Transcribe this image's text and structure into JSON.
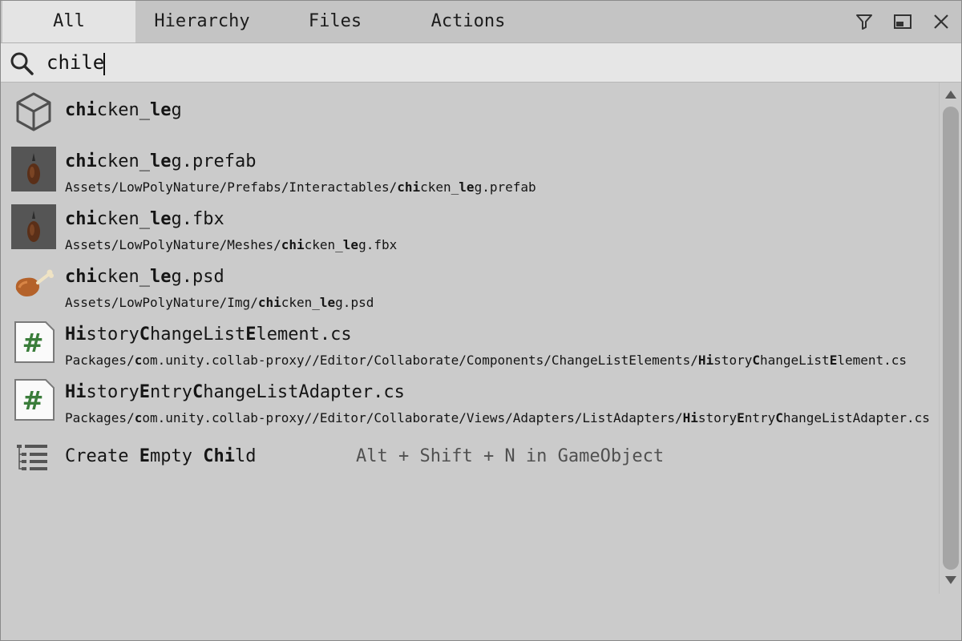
{
  "tabs": [
    {
      "label": "All",
      "active": true
    },
    {
      "label": "Hierarchy",
      "active": false
    },
    {
      "label": "Files",
      "active": false
    },
    {
      "label": "Actions",
      "active": false
    }
  ],
  "toolbar": {
    "icons": [
      "filter-icon",
      "dock-icon",
      "close-icon"
    ]
  },
  "search": {
    "value": "chile",
    "icon": "search-icon"
  },
  "results": [
    {
      "icon": "cube-icon",
      "title_parts": [
        {
          "t": "chi",
          "b": true
        },
        {
          "t": "cken_",
          "b": false
        },
        {
          "t": "le",
          "b": true
        },
        {
          "t": "g",
          "b": false
        }
      ]
    },
    {
      "icon": "prefab-thumbnail-icon",
      "title_parts": [
        {
          "t": "chi",
          "b": true
        },
        {
          "t": "cken_",
          "b": false
        },
        {
          "t": "le",
          "b": true
        },
        {
          "t": "g.prefab",
          "b": false
        }
      ],
      "path_parts": [
        {
          "t": "Assets/LowPolyNature/Prefabs/Interactables/",
          "b": false
        },
        {
          "t": "chi",
          "b": true
        },
        {
          "t": "cken_",
          "b": false
        },
        {
          "t": "le",
          "b": true
        },
        {
          "t": "g.prefab",
          "b": false
        }
      ]
    },
    {
      "icon": "mesh-thumbnail-icon",
      "title_parts": [
        {
          "t": "chi",
          "b": true
        },
        {
          "t": "cken_",
          "b": false
        },
        {
          "t": "le",
          "b": true
        },
        {
          "t": "g.fbx",
          "b": false
        }
      ],
      "path_parts": [
        {
          "t": "Assets/LowPolyNature/Meshes/",
          "b": false
        },
        {
          "t": "chi",
          "b": true
        },
        {
          "t": "cken_",
          "b": false
        },
        {
          "t": "le",
          "b": true
        },
        {
          "t": "g.fbx",
          "b": false
        }
      ]
    },
    {
      "icon": "chicken-leg-image-icon",
      "title_parts": [
        {
          "t": "chi",
          "b": true
        },
        {
          "t": "cken_",
          "b": false
        },
        {
          "t": "le",
          "b": true
        },
        {
          "t": "g.psd",
          "b": false
        }
      ],
      "path_parts": [
        {
          "t": "Assets/LowPolyNature/Img/",
          "b": false
        },
        {
          "t": "chi",
          "b": true
        },
        {
          "t": "cken_",
          "b": false
        },
        {
          "t": "le",
          "b": true
        },
        {
          "t": "g.psd",
          "b": false
        }
      ]
    },
    {
      "icon": "csharp-script-icon",
      "title_parts": [
        {
          "t": "Hi",
          "b": true
        },
        {
          "t": "story",
          "b": false
        },
        {
          "t": "C",
          "b": true
        },
        {
          "t": "hangeList",
          "b": false
        },
        {
          "t": "E",
          "b": true
        },
        {
          "t": "lement.cs",
          "b": false
        }
      ],
      "path_parts": [
        {
          "t": "Packages/",
          "b": false
        },
        {
          "t": "c",
          "b": true
        },
        {
          "t": "om.unity.collab-proxy//Editor/Collaborate/Components/ChangeListElements/",
          "b": false
        },
        {
          "t": "Hi",
          "b": true
        },
        {
          "t": "story",
          "b": false
        },
        {
          "t": "C",
          "b": true
        },
        {
          "t": "hangeList",
          "b": false
        },
        {
          "t": "E",
          "b": true
        },
        {
          "t": "lement.cs",
          "b": false
        }
      ]
    },
    {
      "icon": "csharp-script-icon",
      "title_parts": [
        {
          "t": "Hi",
          "b": true
        },
        {
          "t": "story",
          "b": false
        },
        {
          "t": "E",
          "b": true
        },
        {
          "t": "ntry",
          "b": false
        },
        {
          "t": "C",
          "b": true
        },
        {
          "t": "hangeList",
          "b": false
        },
        {
          "t": "A",
          "b": false
        },
        {
          "t": "dapter.cs",
          "b": false
        }
      ],
      "path_parts": [
        {
          "t": "Packages/",
          "b": false
        },
        {
          "t": "c",
          "b": true
        },
        {
          "t": "om.unity.collab-proxy//Editor/Collaborate/Views/Adapters/ListAdapters/",
          "b": false
        },
        {
          "t": "Hi",
          "b": true
        },
        {
          "t": "story",
          "b": false
        },
        {
          "t": "E",
          "b": true
        },
        {
          "t": "ntry",
          "b": false
        },
        {
          "t": "C",
          "b": true
        },
        {
          "t": "hangeList",
          "b": false
        },
        {
          "t": "Adapter.cs",
          "b": false
        }
      ]
    },
    {
      "icon": "hierarchy-list-icon",
      "title_parts": [
        {
          "t": "Create ",
          "b": false
        },
        {
          "t": "E",
          "b": true
        },
        {
          "t": "mpty ",
          "b": false
        },
        {
          "t": "Chi",
          "b": true
        },
        {
          "t": "l",
          "b": false
        },
        {
          "t": "d",
          "b": false
        }
      ],
      "shortcut": "Alt + Shift + N in GameObject"
    }
  ],
  "colors": {
    "background": "#cbcbcb",
    "tab_active": "#e4e4e4",
    "search_bg": "#e6e6e6",
    "script_hash": "#3a7d3a",
    "scroll_thumb": "#a5a5a5"
  }
}
